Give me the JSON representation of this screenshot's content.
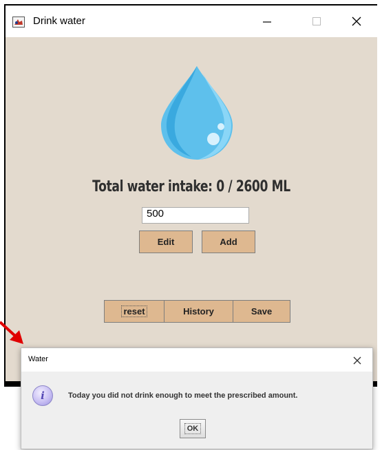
{
  "window": {
    "title": "Drink water",
    "icons": {
      "app": "java-app-icon",
      "minimize": "minimize-icon",
      "maximize": "maximize-icon",
      "close": "close-icon"
    }
  },
  "main": {
    "drop_icon": "water-drop-icon",
    "intake_label": "Total water intake: 0 / 2600 ML",
    "amount_input": "500",
    "buttons": {
      "edit": "Edit",
      "add": "Add",
      "reset": "reset",
      "history": "History",
      "save": "Save"
    }
  },
  "dialog": {
    "title": "Water",
    "message": "Today you did not drink enough to meet the prescribed amount.",
    "ok": "OK",
    "icon": "info-icon"
  },
  "colors": {
    "content_bg": "#e3dace",
    "button_bg": "#deb890",
    "drop_light": "#8fd8f8",
    "drop_dark": "#4cb5e6",
    "annotation_arrow": "#e00000"
  }
}
